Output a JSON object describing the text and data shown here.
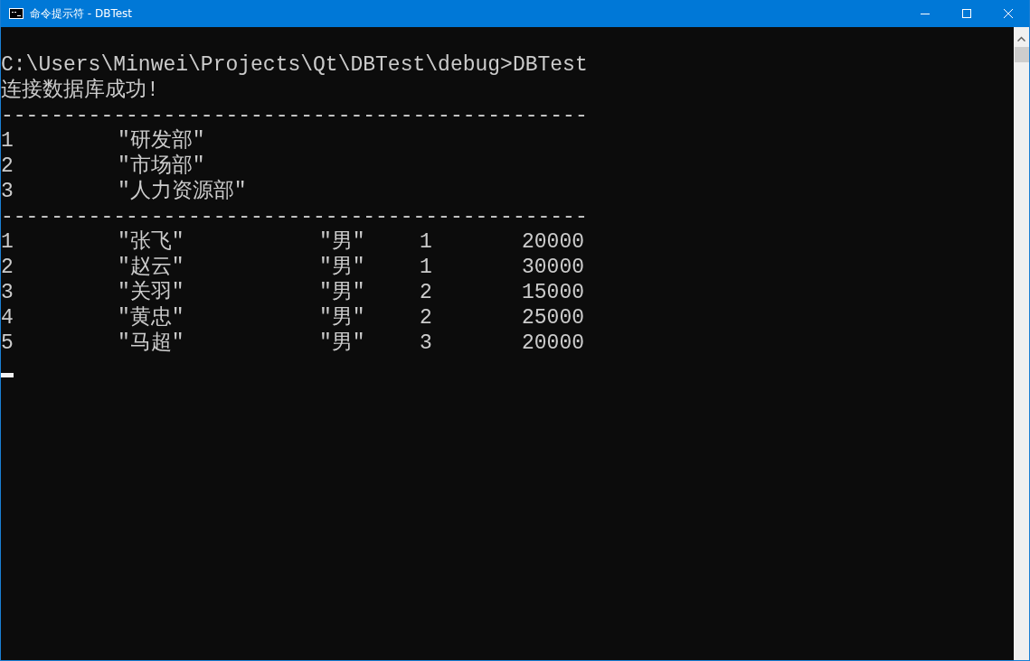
{
  "window": {
    "title": "命令提示符 - DBTest"
  },
  "console": {
    "lines": [
      {
        "kind": "blank"
      },
      {
        "kind": "text",
        "text": "C:\\Users\\Minwei\\Projects\\Qt\\DBTest\\debug>DBTest"
      },
      {
        "kind": "text",
        "text": "连接数据库成功!"
      },
      {
        "kind": "separator",
        "text": "-----------------------------------------------"
      },
      {
        "kind": "row",
        "cells": [
          "1",
          "\"研发部\""
        ]
      },
      {
        "kind": "row",
        "cells": [
          "2",
          "\"市场部\""
        ]
      },
      {
        "kind": "row",
        "cells": [
          "3",
          "\"人力资源部\""
        ]
      },
      {
        "kind": "separator",
        "text": "-----------------------------------------------"
      },
      {
        "kind": "row",
        "cells": [
          "1",
          "\"张飞\"",
          "\"男\"",
          "1",
          "20000"
        ]
      },
      {
        "kind": "row",
        "cells": [
          "2",
          "\"赵云\"",
          "\"男\"",
          "1",
          "30000"
        ]
      },
      {
        "kind": "row",
        "cells": [
          "3",
          "\"关羽\"",
          "\"男\"",
          "2",
          "15000"
        ]
      },
      {
        "kind": "row",
        "cells": [
          "4",
          "\"黄忠\"",
          "\"男\"",
          "2",
          "25000"
        ]
      },
      {
        "kind": "row",
        "cells": [
          "5",
          "\"马超\"",
          "\"男\"",
          "3",
          "20000"
        ]
      },
      {
        "kind": "cursor"
      }
    ]
  }
}
